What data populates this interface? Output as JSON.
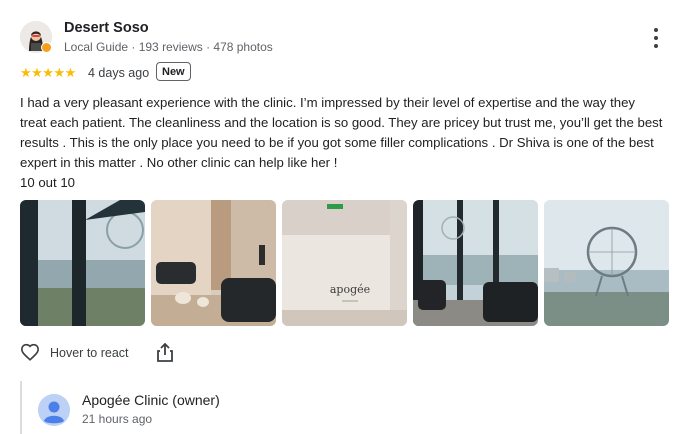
{
  "review": {
    "author_name": "Desert Soso",
    "author_meta": "Local Guide · 193 reviews · 478 photos",
    "rating": 5,
    "stars_text": "★★★★★",
    "date": "4 days ago",
    "new_badge": "New",
    "text_paragraph": "I had a very pleasant experience with the clinic. I’m impressed by their level of expertise and the way they treat each patient. The cleanliness and the location is so good. They are pricey but trust me, you’ll get the best results . This is the only place you need to be if you got some filler complications . Dr Shiva is one of the best expert in this matter . No other clinic can help like her !",
    "text_score": "10 out 10",
    "photos": [
      {
        "subject": "window-city-view"
      },
      {
        "subject": "waiting-room-sofas"
      },
      {
        "subject": "apogee-logo-wall"
      },
      {
        "subject": "lounge-window-view"
      },
      {
        "subject": "ain-dubai-wheel"
      }
    ]
  },
  "actions": {
    "react_label": "Hover to react",
    "react_icon": "heart-outline-icon",
    "share_icon": "share-icon"
  },
  "owner_reply": {
    "name": "Apogée Clinic (owner)",
    "time": "21 hours ago",
    "avatar_icon": "person-avatar-icon"
  },
  "colors": {
    "star": "#fbbc04",
    "text": "#202124",
    "secondary": "#5f6368",
    "owner_avatar": "#bcd1f5"
  }
}
